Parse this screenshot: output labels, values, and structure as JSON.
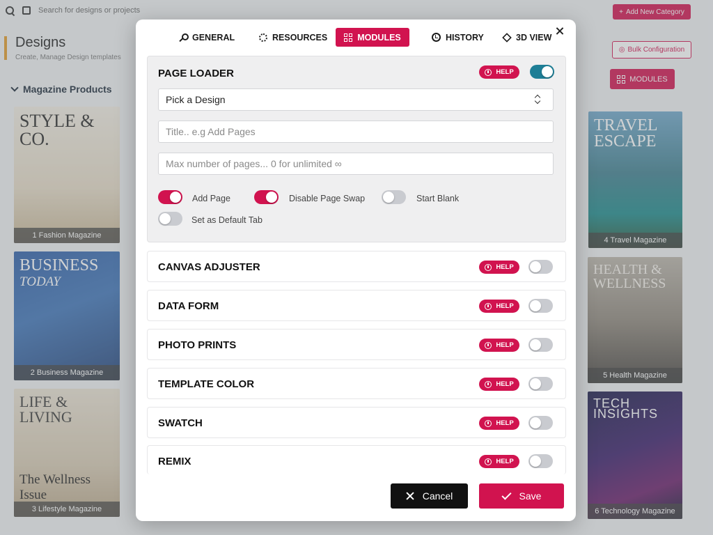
{
  "background": {
    "search_placeholder": "Search for designs or projects",
    "add_category_label": "Add New Category",
    "page_title": "Designs",
    "page_subtitle": "Create, Manage Design templates",
    "bulk_config_label": "Bulk Configuration",
    "modules_button_label": "MODULES",
    "magazine_header": "Magazine Products",
    "magazines": [
      {
        "cover_title": "STYLE & CO.",
        "caption": "1 Fashion Magazine"
      },
      {
        "cover_title": "BUSINESS",
        "cover_subtitle": "TODAY",
        "caption": "2 Business Magazine"
      },
      {
        "cover_title": "LIFE & LIVING",
        "cover_subtitle": "The Wellness Issue",
        "caption": "3 Lifestyle Magazine"
      },
      {
        "cover_title": "TRAVEL",
        "cover_subtitle": "ESCAPE",
        "caption": "4 Travel Magazine"
      },
      {
        "cover_title": "HEALTH &",
        "cover_subtitle": "WELLNESS",
        "caption": "5 Health Magazine"
      },
      {
        "cover_title": "TECH",
        "cover_subtitle": "INSIGHTS",
        "caption": "6 Technology Magazine"
      }
    ]
  },
  "modal": {
    "tabs": [
      {
        "label": "GENERAL",
        "icon": "wrench-icon"
      },
      {
        "label": "RESOURCES",
        "icon": "gear-icon"
      },
      {
        "label": "MODULES",
        "icon": "grid-icon",
        "active": true
      },
      {
        "label": "HISTORY",
        "icon": "clock-icon"
      },
      {
        "label": "3D VIEW",
        "icon": "cube-icon"
      }
    ],
    "help_label": "HELP",
    "page_loader": {
      "title": "PAGE LOADER",
      "enabled": true,
      "design_select_value": "Pick a Design",
      "title_placeholder": "Title.. e.g Add Pages",
      "max_pages_placeholder": "Max number of pages... 0 for unlimited ∞",
      "options": [
        {
          "label": "Add Page",
          "on": true
        },
        {
          "label": "Disable Page Swap",
          "on": true
        },
        {
          "label": "Start Blank",
          "on": false
        },
        {
          "label": "Set as Default Tab",
          "on": false
        }
      ]
    },
    "modules": [
      {
        "title": "CANVAS ADJUSTER",
        "on": false
      },
      {
        "title": "DATA FORM",
        "on": false
      },
      {
        "title": "PHOTO PRINTS",
        "on": false
      },
      {
        "title": "TEMPLATE COLOR",
        "on": false
      },
      {
        "title": "SWATCH",
        "on": false
      },
      {
        "title": "REMIX",
        "on": false
      }
    ],
    "cancel_label": "Cancel",
    "save_label": "Save"
  },
  "colors": {
    "accent": "#d1134f",
    "toggle_teal": "#1e7e96",
    "cancel_bg": "#111111"
  }
}
